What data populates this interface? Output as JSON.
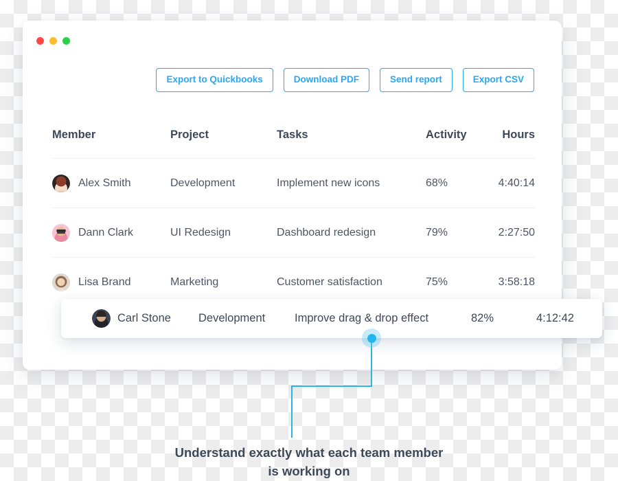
{
  "window": {
    "traffic_lights": [
      {
        "name": "close",
        "color": "#fb4a43"
      },
      {
        "name": "minimize",
        "color": "#fdbb2d"
      },
      {
        "name": "maximize",
        "color": "#2bd049"
      }
    ]
  },
  "toolbar": {
    "buttons": [
      {
        "label": "Export to Quickbooks"
      },
      {
        "label": "Download PDF"
      },
      {
        "label": "Send report"
      },
      {
        "label": "Export CSV"
      }
    ],
    "accent_color": "#28a8f5"
  },
  "table": {
    "columns": [
      "Member",
      "Project",
      "Tasks",
      "Activity",
      "Hours"
    ],
    "rows": [
      {
        "member": "Alex Smith",
        "project": "Development",
        "task": "Implement new icons",
        "activity": "68%",
        "hours": "4:40:14",
        "avatar": "avatar-alex-smith"
      },
      {
        "member": "Dann Clark",
        "project": "UI Redesign",
        "task": "Dashboard redesign",
        "activity": "79%",
        "hours": "2:27:50",
        "avatar": "avatar-dann-clark"
      },
      {
        "member": "Lisa Brand",
        "project": "Marketing",
        "task": "Customer satisfaction",
        "activity": "75%",
        "hours": "3:58:18",
        "avatar": "avatar-lisa-brand"
      }
    ]
  },
  "highlighted_row": {
    "member": "Carl Stone",
    "project": "Development",
    "task": "Improve drag & drop effect",
    "activity": "82%",
    "hours": "4:12:42",
    "avatar": "avatar-carl-stone"
  },
  "callout": {
    "line1": "Understand exactly what each team member",
    "line2": "is working on",
    "line_color": "#29b3ef",
    "pin_color": "#21b6f0"
  }
}
